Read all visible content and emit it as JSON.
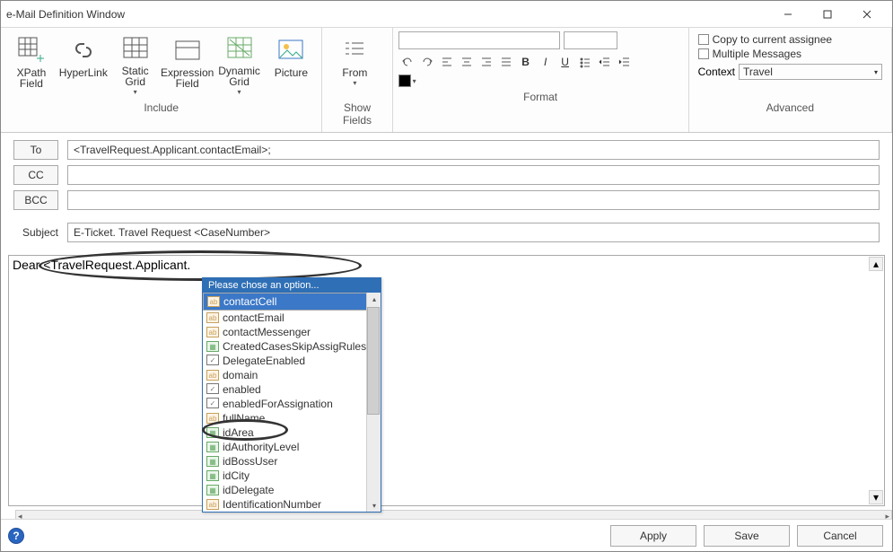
{
  "window": {
    "title": "e-Mail Definition Window"
  },
  "ribbon": {
    "include": {
      "label": "Include",
      "xpath_field": "XPath\nField",
      "hyperlink": "HyperLink",
      "static_grid": "Static\nGrid",
      "expression_field": "Expression\nField",
      "dynamic_grid": "Dynamic\nGrid",
      "picture": "Picture"
    },
    "showfields": {
      "label": "Show Fields",
      "from": "From"
    },
    "format": {
      "label": "Format"
    },
    "advanced": {
      "label": "Advanced",
      "copy_assignee": "Copy to current assignee",
      "multiple_messages": "Multiple Messages",
      "context_label": "Context",
      "context_value": "Travel"
    }
  },
  "fields": {
    "to_btn": "To",
    "to_value": "<TravelRequest.Applicant.contactEmail>;",
    "cc_btn": "CC",
    "cc_value": "",
    "bcc_btn": "BCC",
    "bcc_value": "",
    "subject_label": "Subject",
    "subject_value": "E-Ticket. Travel Request <CaseNumber>"
  },
  "editor": {
    "body_text": "Dear <TravelRequest.Applicant."
  },
  "popup": {
    "header": "Please chose an option...",
    "items": [
      {
        "label": "contactCell",
        "icon": "ab",
        "selected": true
      },
      {
        "label": "contactEmail",
        "icon": "ab"
      },
      {
        "label": "contactMessenger",
        "icon": "ab"
      },
      {
        "label": "CreatedCasesSkipAssigRules",
        "icon": "tbl"
      },
      {
        "label": "DelegateEnabled",
        "icon": "chk"
      },
      {
        "label": "domain",
        "icon": "ab"
      },
      {
        "label": "enabled",
        "icon": "chk"
      },
      {
        "label": "enabledForAssignation",
        "icon": "chk"
      },
      {
        "label": "fullName",
        "icon": "ab"
      },
      {
        "label": "idArea",
        "icon": "tbl"
      },
      {
        "label": "idAuthorityLevel",
        "icon": "tbl"
      },
      {
        "label": "idBossUser",
        "icon": "tbl"
      },
      {
        "label": "idCity",
        "icon": "tbl"
      },
      {
        "label": "idDelegate",
        "icon": "tbl"
      },
      {
        "label": "IdentificationNumber",
        "icon": "ab"
      }
    ]
  },
  "bottom": {
    "apply": "Apply",
    "save": "Save",
    "cancel": "Cancel"
  }
}
